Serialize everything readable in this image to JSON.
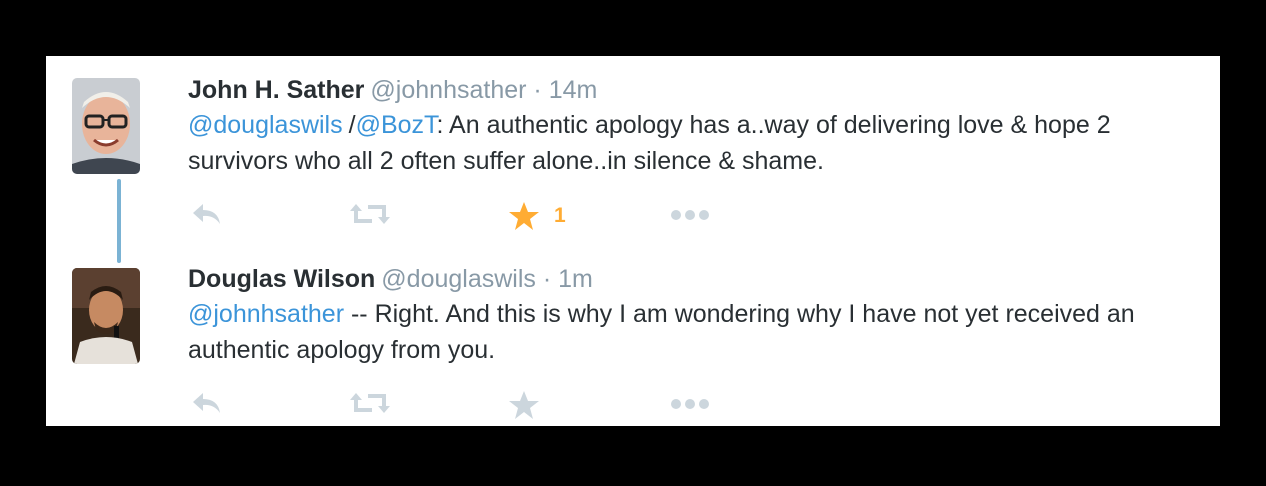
{
  "tweets": [
    {
      "name": "John H. Sather",
      "handle": "@johnhsather",
      "sep": "·",
      "time": "14m",
      "mention1": "@douglaswils",
      "slash": "/",
      "mention2": "@BozT",
      "text": ": An authentic apology has a..way of delivering love & hope 2 survivors who all 2 often suffer alone..in silence & shame.",
      "favorite_count": "1"
    },
    {
      "name": "Douglas Wilson",
      "handle": "@douglaswils",
      "sep": "·",
      "time": "1m",
      "mention1": "@johnhsather",
      "text": " -- Right. And this is why I am wondering why I have not yet received an authentic apology from you."
    }
  ],
  "actions": [
    "reply-icon",
    "retweet-icon",
    "favorite-icon",
    "more-icon"
  ],
  "colors": {
    "accent_link": "#3b94d9",
    "favorite_active": "#ffac33",
    "icon_inactive": "#ccd6dd",
    "thread_line": "#7bb3d4"
  }
}
